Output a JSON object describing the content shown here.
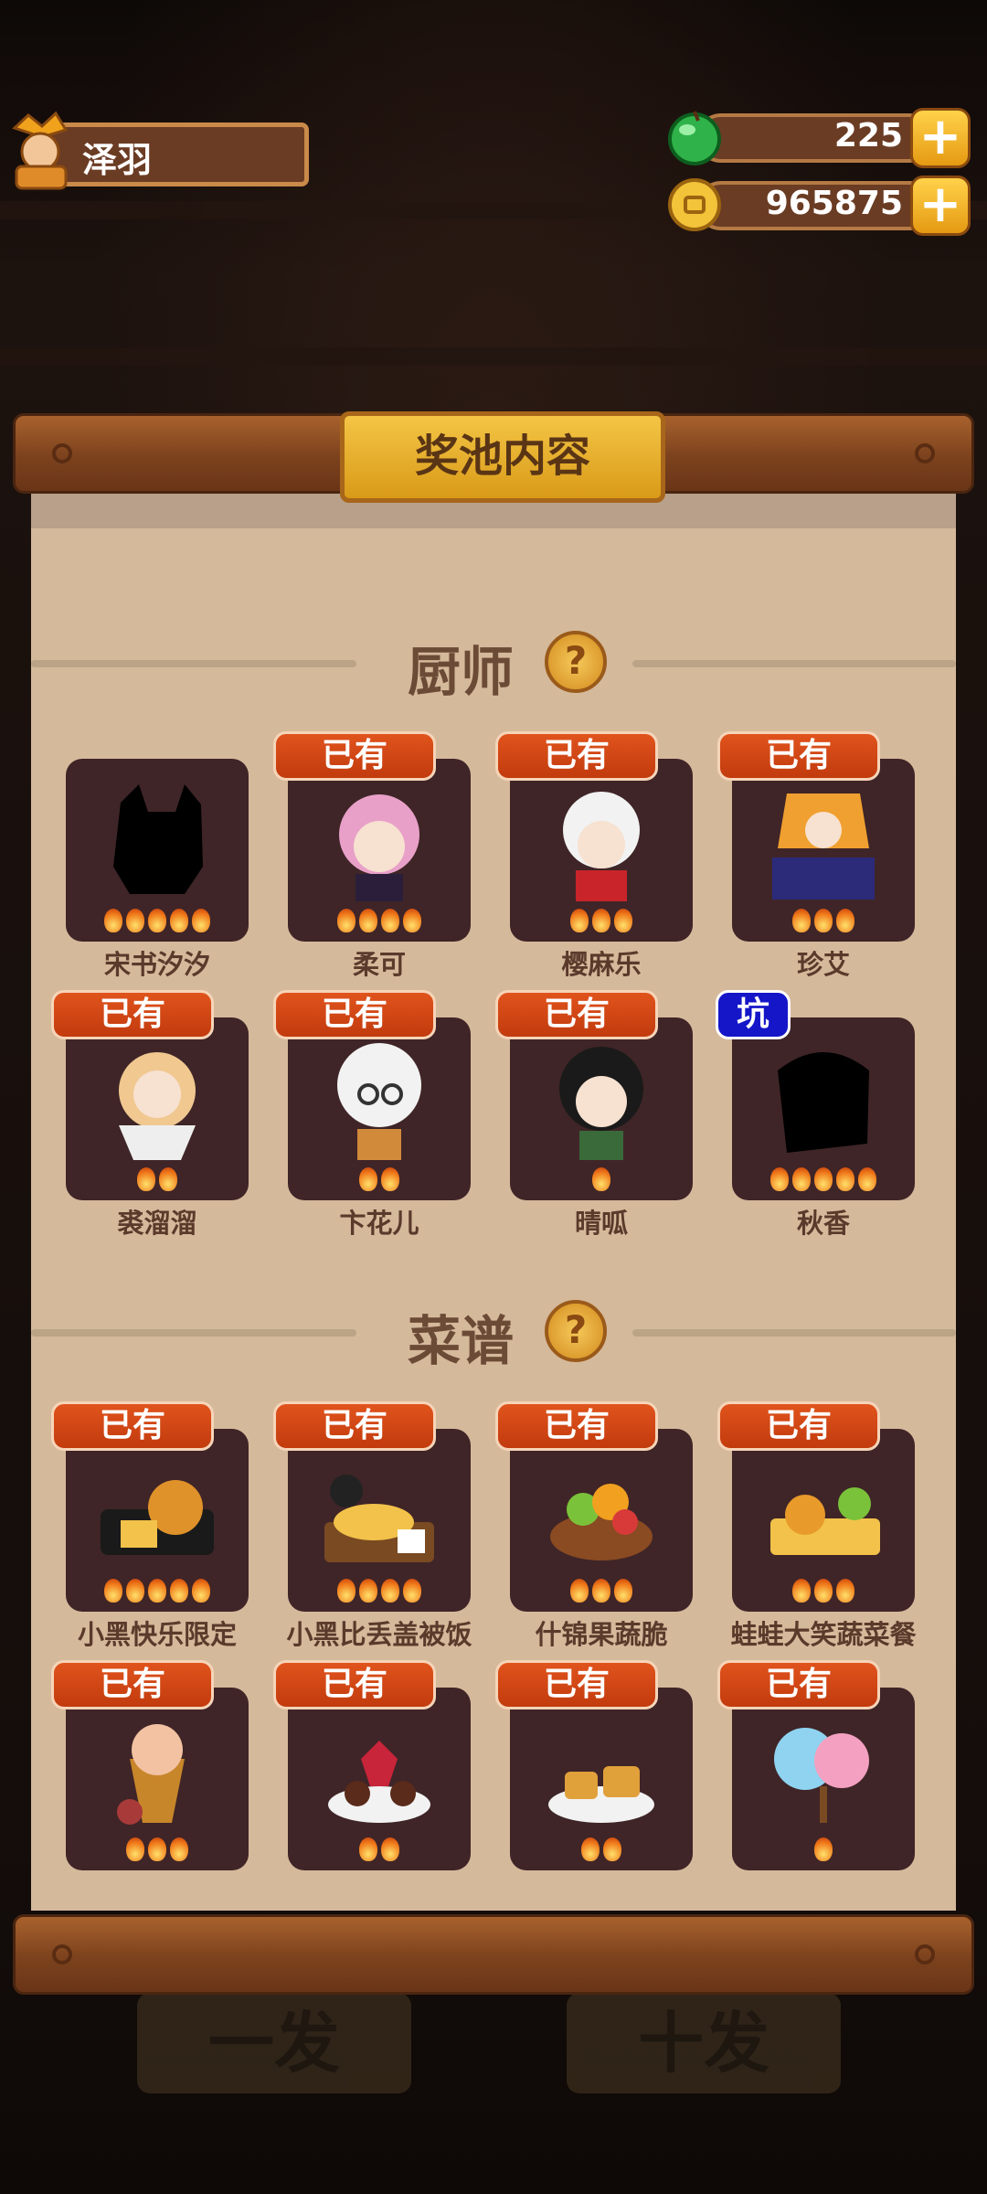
{
  "player": {
    "name": "泽羽",
    "avatar_icon": "chef-avatar-icon"
  },
  "resources": [
    {
      "icon": "green-gem-icon",
      "value": "225"
    },
    {
      "icon": "gold-coin-icon",
      "value": "965875"
    }
  ],
  "panel_title": "奖池内容",
  "background_buttons": [
    "一发",
    "十发"
  ],
  "sections": {
    "chefs": {
      "title": "厨师",
      "items": [
        {
          "name": "宋书汐汐",
          "tag": "",
          "flames": 5
        },
        {
          "name": "柔可",
          "tag": "已有",
          "flames": 4
        },
        {
          "name": "樱麻乐",
          "tag": "已有",
          "flames": 3
        },
        {
          "name": "珍艾",
          "tag": "已有",
          "flames": 3
        },
        {
          "name": "裘溜溜",
          "tag": "已有",
          "flames": 2
        },
        {
          "name": "卞花儿",
          "tag": "已有",
          "flames": 2
        },
        {
          "name": "晴呱",
          "tag": "已有",
          "flames": 1
        },
        {
          "name": "秋香",
          "tag": "坑",
          "flames": 5
        }
      ]
    },
    "recipes": {
      "title": "菜谱",
      "items": [
        {
          "name": "小黑快乐限定",
          "tag": "已有",
          "flames": 5
        },
        {
          "name": "小黑比丢盖被饭",
          "tag": "已有",
          "flames": 4
        },
        {
          "name": "什锦果蔬脆",
          "tag": "已有",
          "flames": 3
        },
        {
          "name": "蛙蛙大笑蔬菜餐",
          "tag": "已有",
          "flames": 3
        },
        {
          "name": "",
          "tag": "已有",
          "flames": 3
        },
        {
          "name": "",
          "tag": "已有",
          "flames": 2
        },
        {
          "name": "",
          "tag": "已有",
          "flames": 2
        },
        {
          "name": "",
          "tag": "已有",
          "flames": 1
        }
      ]
    }
  },
  "colors": {
    "tag_owned": "#d04314",
    "tag_pit": "#1416c8",
    "panel": "#d5b99b",
    "card": "#3f2527"
  }
}
